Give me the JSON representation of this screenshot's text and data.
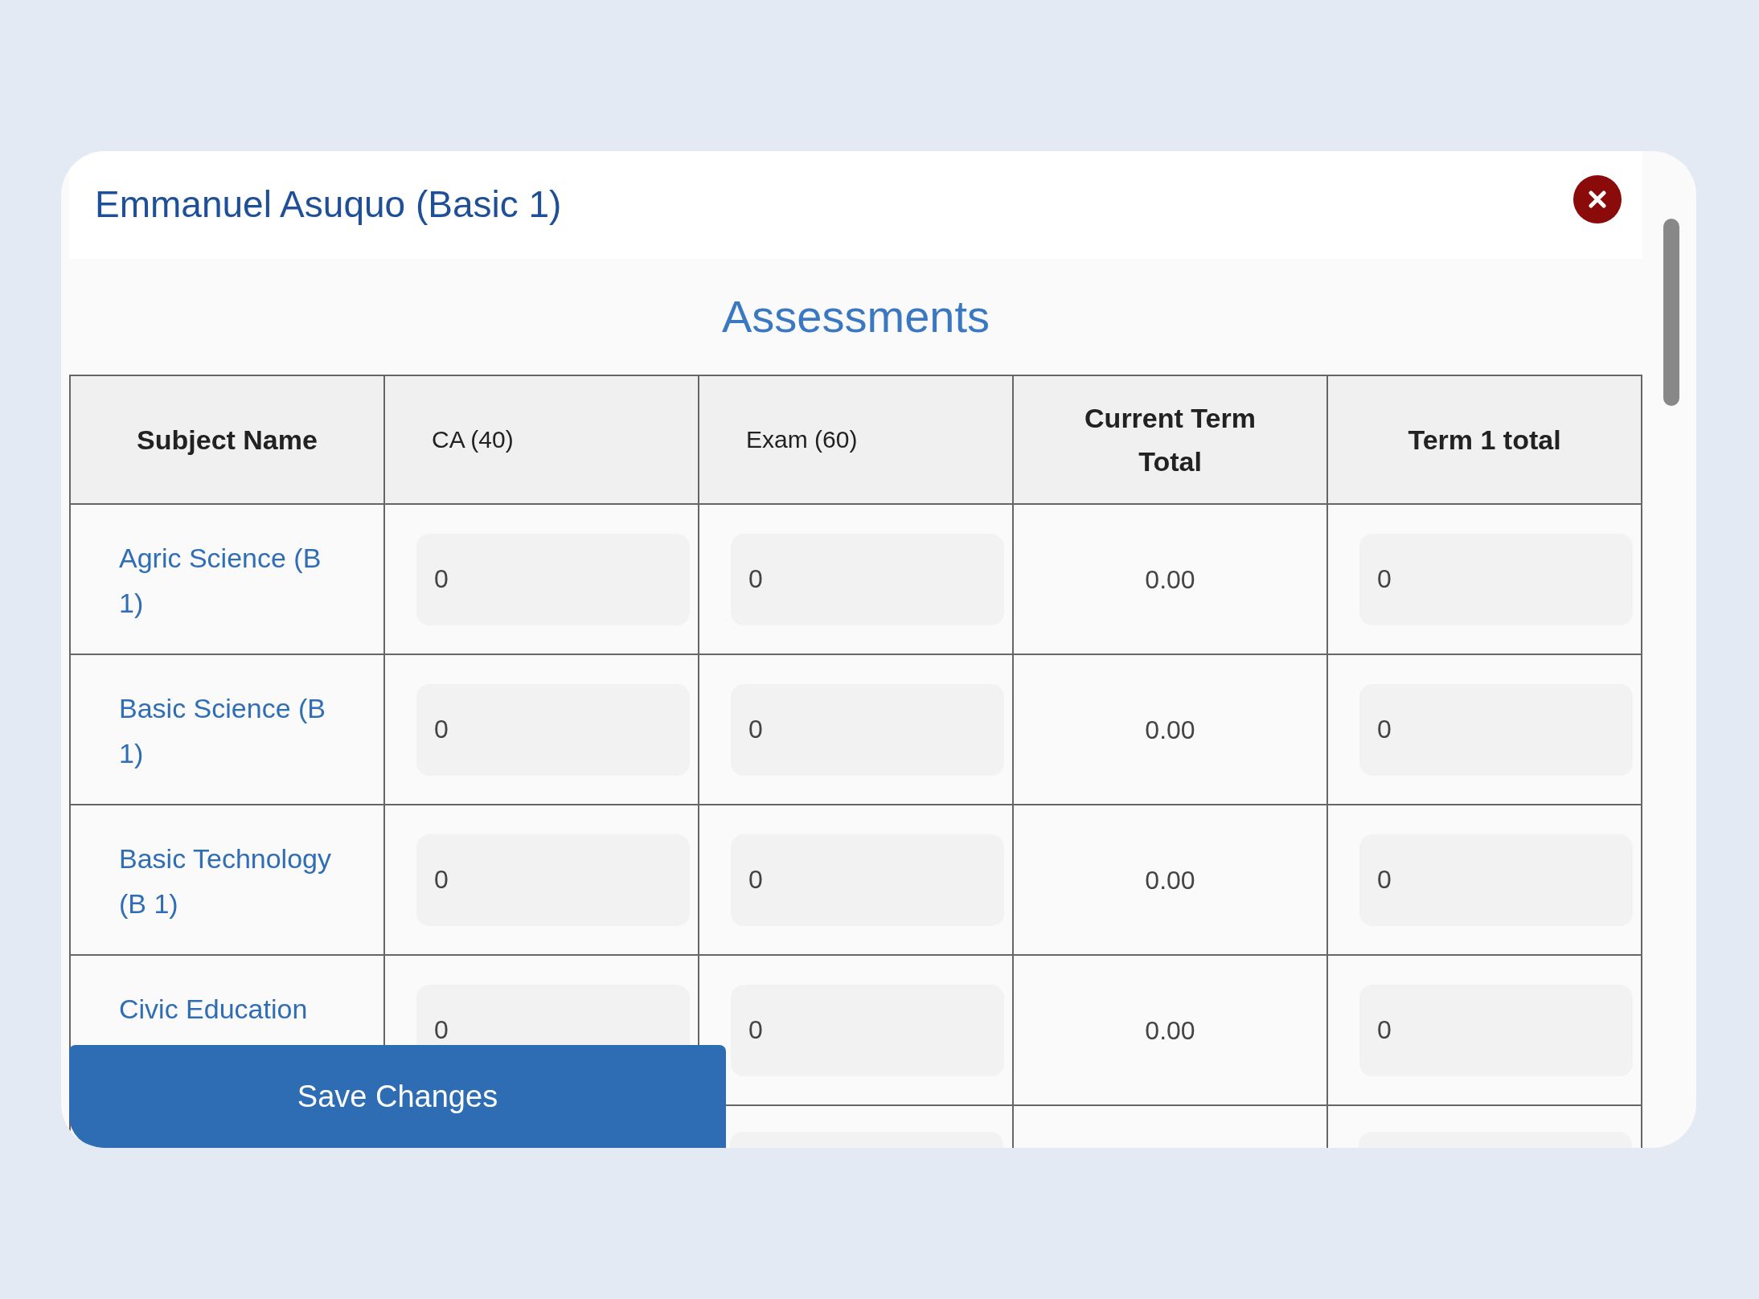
{
  "dialog": {
    "title": "Emmanuel Asuquo (Basic 1)",
    "section_title": "Assessments",
    "table": {
      "columns": [
        "Subject Name",
        "CA (40)",
        "Exam (60)",
        "Current Term Total",
        "Term 1 total"
      ],
      "rows": [
        {
          "subject": "Agric Science (B 1)",
          "ca": "0",
          "exam": "0",
          "current_total": "0.00",
          "term1_total": "0"
        },
        {
          "subject": "Basic Science (B 1)",
          "ca": "0",
          "exam": "0",
          "current_total": "0.00",
          "term1_total": "0"
        },
        {
          "subject": "Basic Technology (B 1)",
          "ca": "0",
          "exam": "0",
          "current_total": "0.00",
          "term1_total": "0"
        },
        {
          "subject": "Civic Education",
          "ca": "0",
          "exam": "0",
          "current_total": "0.00",
          "term1_total": "0"
        }
      ]
    },
    "save_button": "Save Changes"
  }
}
